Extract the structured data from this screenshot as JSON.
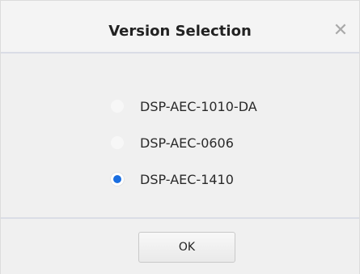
{
  "dialog": {
    "title": "Version Selection",
    "close_glyph": "✕",
    "options": [
      {
        "label": "DSP-AEC-1010-DA",
        "selected": false
      },
      {
        "label": "DSP-AEC-0606",
        "selected": false
      },
      {
        "label": "DSP-AEC-1410",
        "selected": true
      }
    ],
    "ok_label": "OK"
  },
  "colors": {
    "accent": "#1a6ee0",
    "background": "#f0f0f0",
    "divider": "#dadde6"
  }
}
